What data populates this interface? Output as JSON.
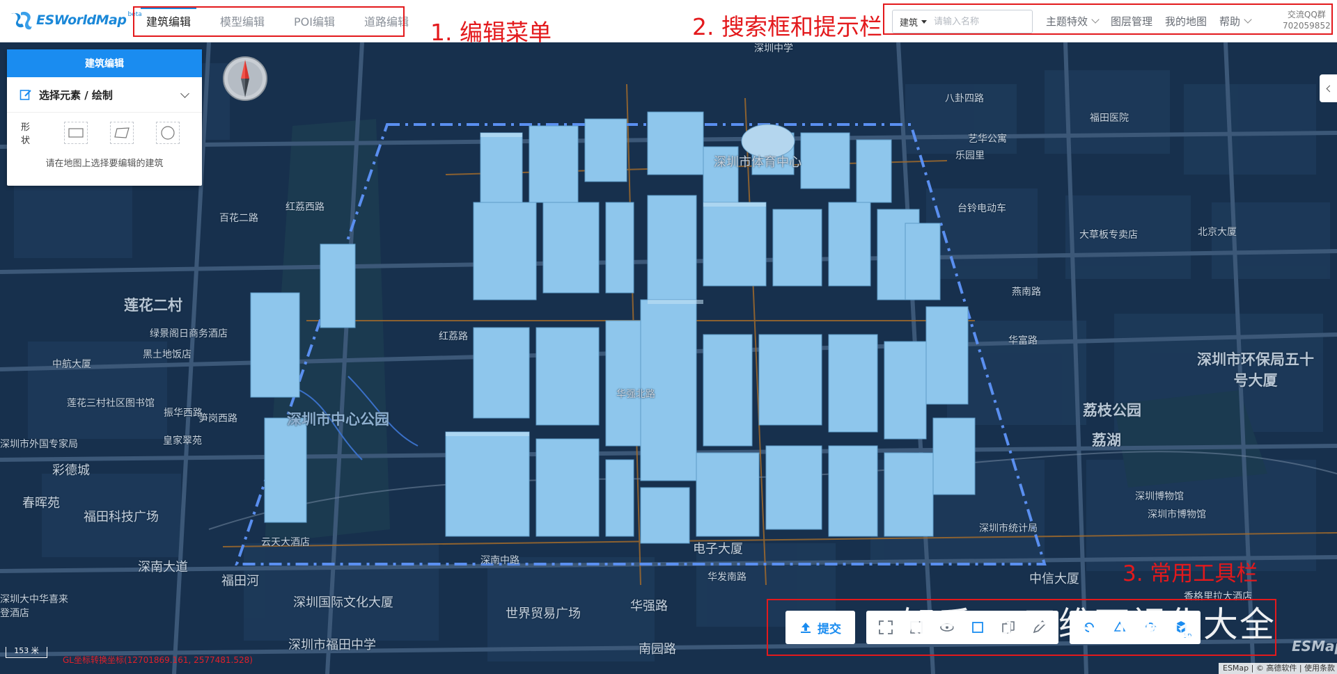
{
  "app": {
    "logo_text": "ESWorldMap",
    "logo_badge": "beta"
  },
  "tabs": [
    {
      "label": "建筑编辑"
    },
    {
      "label": "模型编辑"
    },
    {
      "label": "POI编辑"
    },
    {
      "label": "道路编辑"
    }
  ],
  "search": {
    "type_label": "建筑",
    "placeholder": "请输入名称"
  },
  "topmenu": {
    "items": [
      {
        "label": "主题特效"
      },
      {
        "label": "图层管理"
      },
      {
        "label": "我的地图"
      },
      {
        "label": "帮助"
      }
    ],
    "qq_line1": "交流QQ群",
    "qq_line2": "702059852"
  },
  "annotations": {
    "edit_menu": "1. 编辑菜单",
    "search_bar": "2. 搜索框和提示栏",
    "toolbar": "3. 常用工具栏"
  },
  "panel": {
    "title": "建筑编辑",
    "select_label": "选择元素 / 绘制",
    "shape_label": "形状",
    "hint": "请在地图上选择要编辑的建筑"
  },
  "toolbar": {
    "submit_label": "提交",
    "badge_3d": "3D"
  },
  "watermark": "知乎 @三维可视化大全",
  "map": {
    "scale_label": "153 米",
    "coords": "GL坐标转换坐标(12701869.161, 2577481.528)",
    "copyright": "ESMap | © 高德软件 | 使用条款",
    "brand": "ESMap",
    "labels": [
      "深圳中学",
      "深圳市体育中心",
      "艺华公寓",
      "乐园里",
      "福田医院",
      "台铃电动车",
      "北京大厦",
      "大草板专卖店",
      "红荔西路",
      "莲花二村",
      "绿景阁日商务酒店",
      "红荔路",
      "深圳市环保局五十号大厦",
      "荔枝公园",
      "荔湖",
      "深圳市中心公园",
      "深圳市外国专家局",
      "皇家翠苑",
      "彩德城",
      "春晖苑",
      "福田科技广场",
      "云天大酒店",
      "深南大道",
      "深南中路",
      "电子大厦",
      "深圳市统计局",
      "深圳博物馆",
      "中信大厦",
      "深圳国际文化大厦",
      "世界贸易广场",
      "华强路",
      "深圳市福田中学",
      "南园路",
      "华发南路",
      "香格里拉大酒店",
      "深圳大中华喜来登酒店",
      "深圳市博物馆",
      "莲花三村社区图书馆",
      "黑土地饭店",
      "中航大厦",
      "福田河",
      "笋岗西路",
      "振华西路",
      "燕南路",
      "华强北路",
      "华富路",
      "百花二路",
      "八卦四路"
    ]
  }
}
